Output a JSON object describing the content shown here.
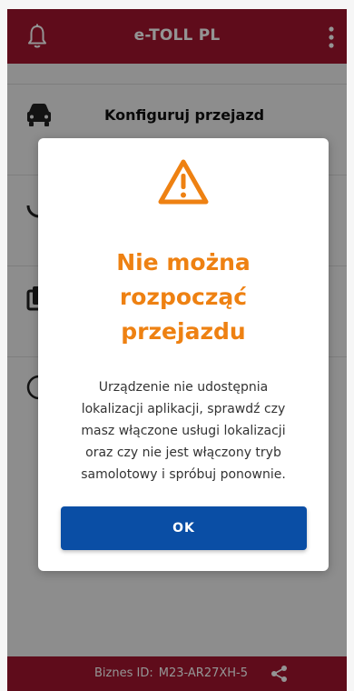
{
  "app": {
    "title": "e-TOLL PL",
    "icons": {
      "notifications": "bell-icon",
      "menu": "more-vertical-icon"
    }
  },
  "menu_items": [
    {
      "label": "Konfiguruj przejazd",
      "icon": "car-icon"
    },
    {
      "label": "",
      "icon": "history-icon"
    },
    {
      "label": "",
      "icon": "documents-icon"
    },
    {
      "label": "",
      "icon": "help-icon"
    }
  ],
  "dialog": {
    "icon": "warning-icon",
    "title_lines": [
      "Nie można",
      "rozpocząć",
      "przejazdu"
    ],
    "message_lines": [
      "Urządzenie nie udostępnia",
      "lokalizacji aplikacji, sprawdź czy",
      "masz włączone usługi lokalizacji",
      "oraz czy nie jest włączony tryb",
      "samolotowy i spróbuj ponownie."
    ],
    "ok_label": "OK"
  },
  "footer": {
    "business_id_label": "Biznes ID:",
    "business_id_value": "M23-AR27XH-5",
    "share_icon": "share-icon"
  },
  "colors": {
    "brand_red": "#a4162f",
    "warning_orange": "#ee8112",
    "button_blue": "#0a4ea5"
  }
}
